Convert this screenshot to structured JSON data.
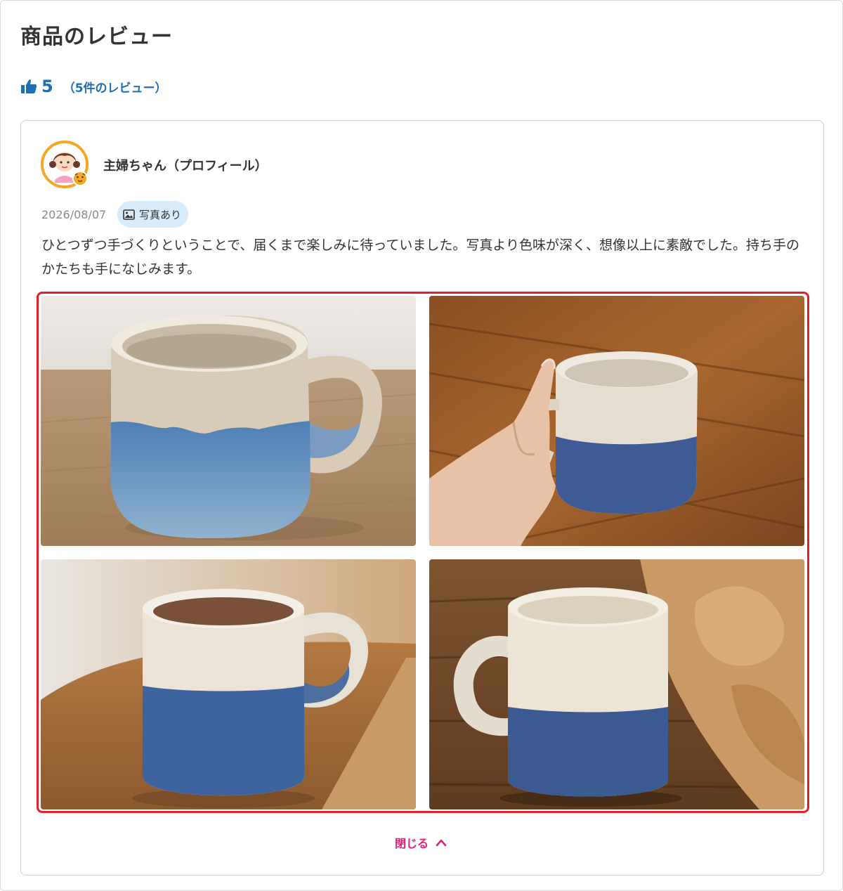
{
  "header": {
    "title": "商品のレビュー"
  },
  "rating": {
    "score": "5",
    "review_count_label": "（5件のレビュー）",
    "color": "#1f6fb5",
    "icon": "thumbs-up-icon"
  },
  "review": {
    "user_name": "主婦ちゃん（プロフィール）",
    "avatar_icon": "housewife-avatar-with-tiger-badge",
    "date": "2026/08/07",
    "photo_badge_label": "写真あり",
    "photo_badge_icon": "image-icon",
    "text": "ひとつずつ手づくりということで、届くまで楽しみに待っていました。写真より色味が深く、想像以上に素敵でした。持ち手のかたちも手になじみます。",
    "photos": [
      {
        "description": "blue-glazed-mug-on-table"
      },
      {
        "description": "mug-held-in-hand"
      },
      {
        "description": "mug-with-coffee"
      },
      {
        "description": "mug-with-kraft-paper"
      }
    ],
    "close_label": "閉じる",
    "close_icon": "chevron-up-icon",
    "accent_color": "#e0207a",
    "highlight_border_color": "#e0202a"
  }
}
